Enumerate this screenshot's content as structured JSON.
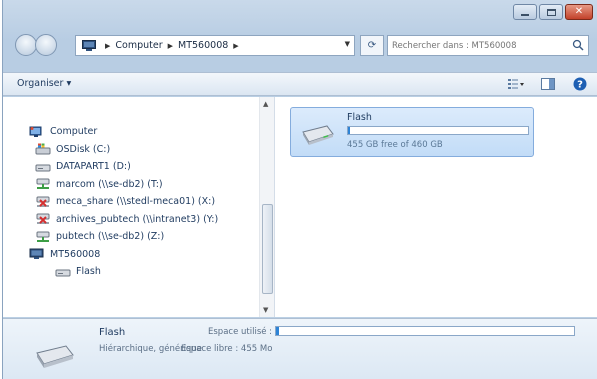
{
  "window": {
    "address": {
      "crumbs": [
        "Computer",
        "MT560008"
      ]
    },
    "search": {
      "placeholder": "Rechercher dans : MT560008"
    },
    "toolbar": {
      "organize_label": "Organiser ▾"
    }
  },
  "tree": [
    {
      "label": "Computer",
      "icon": "computer-icon",
      "level": 0
    },
    {
      "label": "OSDisk (C:)",
      "icon": "os-drive-icon",
      "level": 1
    },
    {
      "label": "DATAPART1 (D:)",
      "icon": "drive-icon",
      "level": 1
    },
    {
      "label": "marcom (\\\\se-db2) (T:)",
      "icon": "network-drive-icon",
      "level": 1
    },
    {
      "label": "meca_share (\\\\stedl-meca01) (X:)",
      "icon": "network-drive-disconnected-icon",
      "level": 1
    },
    {
      "label": "archives_pubtech (\\\\intranet3) (Y:)",
      "icon": "network-drive-disconnected-icon",
      "level": 1
    },
    {
      "label": "pubtech (\\\\se-db2) (Z:)",
      "icon": "network-drive-icon",
      "level": 1
    },
    {
      "label": "MT560008",
      "icon": "device-icon",
      "level": 0
    },
    {
      "label": "Flash",
      "icon": "drive-icon",
      "level": 2
    }
  ],
  "drive_tile": {
    "name": "Flash",
    "free_text": "455 GB free of 460 GB",
    "used_fraction": 0.011
  },
  "details": {
    "name": "Flash",
    "type": "Hiérarchique, générique",
    "used_label": "Espace utilisé :",
    "free_label": "Espace libre : 455 Mo",
    "used_fraction": 0.01
  },
  "colors": {
    "accent": "#2d83d6",
    "highlight_oval": "#e0262b",
    "tile_bg": "#c2dcf7"
  }
}
